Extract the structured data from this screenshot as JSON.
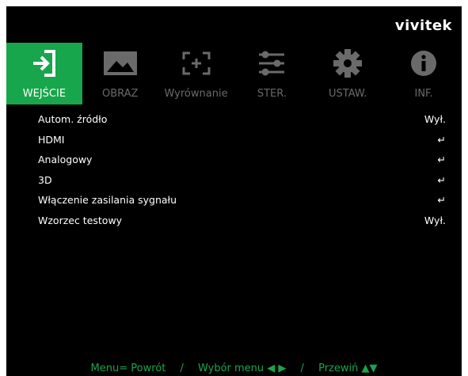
{
  "brand": "vivitek",
  "tabs": [
    {
      "label": "WEJŚCIE",
      "icon": "input-arrow-icon",
      "active": true
    },
    {
      "label": "OBRAZ",
      "icon": "picture-icon"
    },
    {
      "label": "Wyrównanie",
      "icon": "alignment-icon"
    },
    {
      "label": "STER.",
      "icon": "sliders-icon"
    },
    {
      "label": "USTAW.",
      "icon": "gear-icon"
    },
    {
      "label": "INF.",
      "icon": "info-icon"
    }
  ],
  "menu": [
    {
      "label": "Autom. źródło",
      "value": "Wył."
    },
    {
      "label": "HDMI",
      "value": "↵"
    },
    {
      "label": "Analogowy",
      "value": "↵"
    },
    {
      "label": "3D",
      "value": "↵"
    },
    {
      "label": "Włączenie zasilania sygnału",
      "value": "↵"
    },
    {
      "label": "Wzorzec testowy",
      "value": "Wył."
    }
  ],
  "footer": {
    "back": "Menu= Powrót",
    "select": "Wybór menu ◀ ▶",
    "scroll": "Przewiń ▲▼",
    "separator": "/"
  },
  "colors": {
    "accent": "#17a64b",
    "inactive": "#6a6a6a",
    "background": "#000000"
  }
}
